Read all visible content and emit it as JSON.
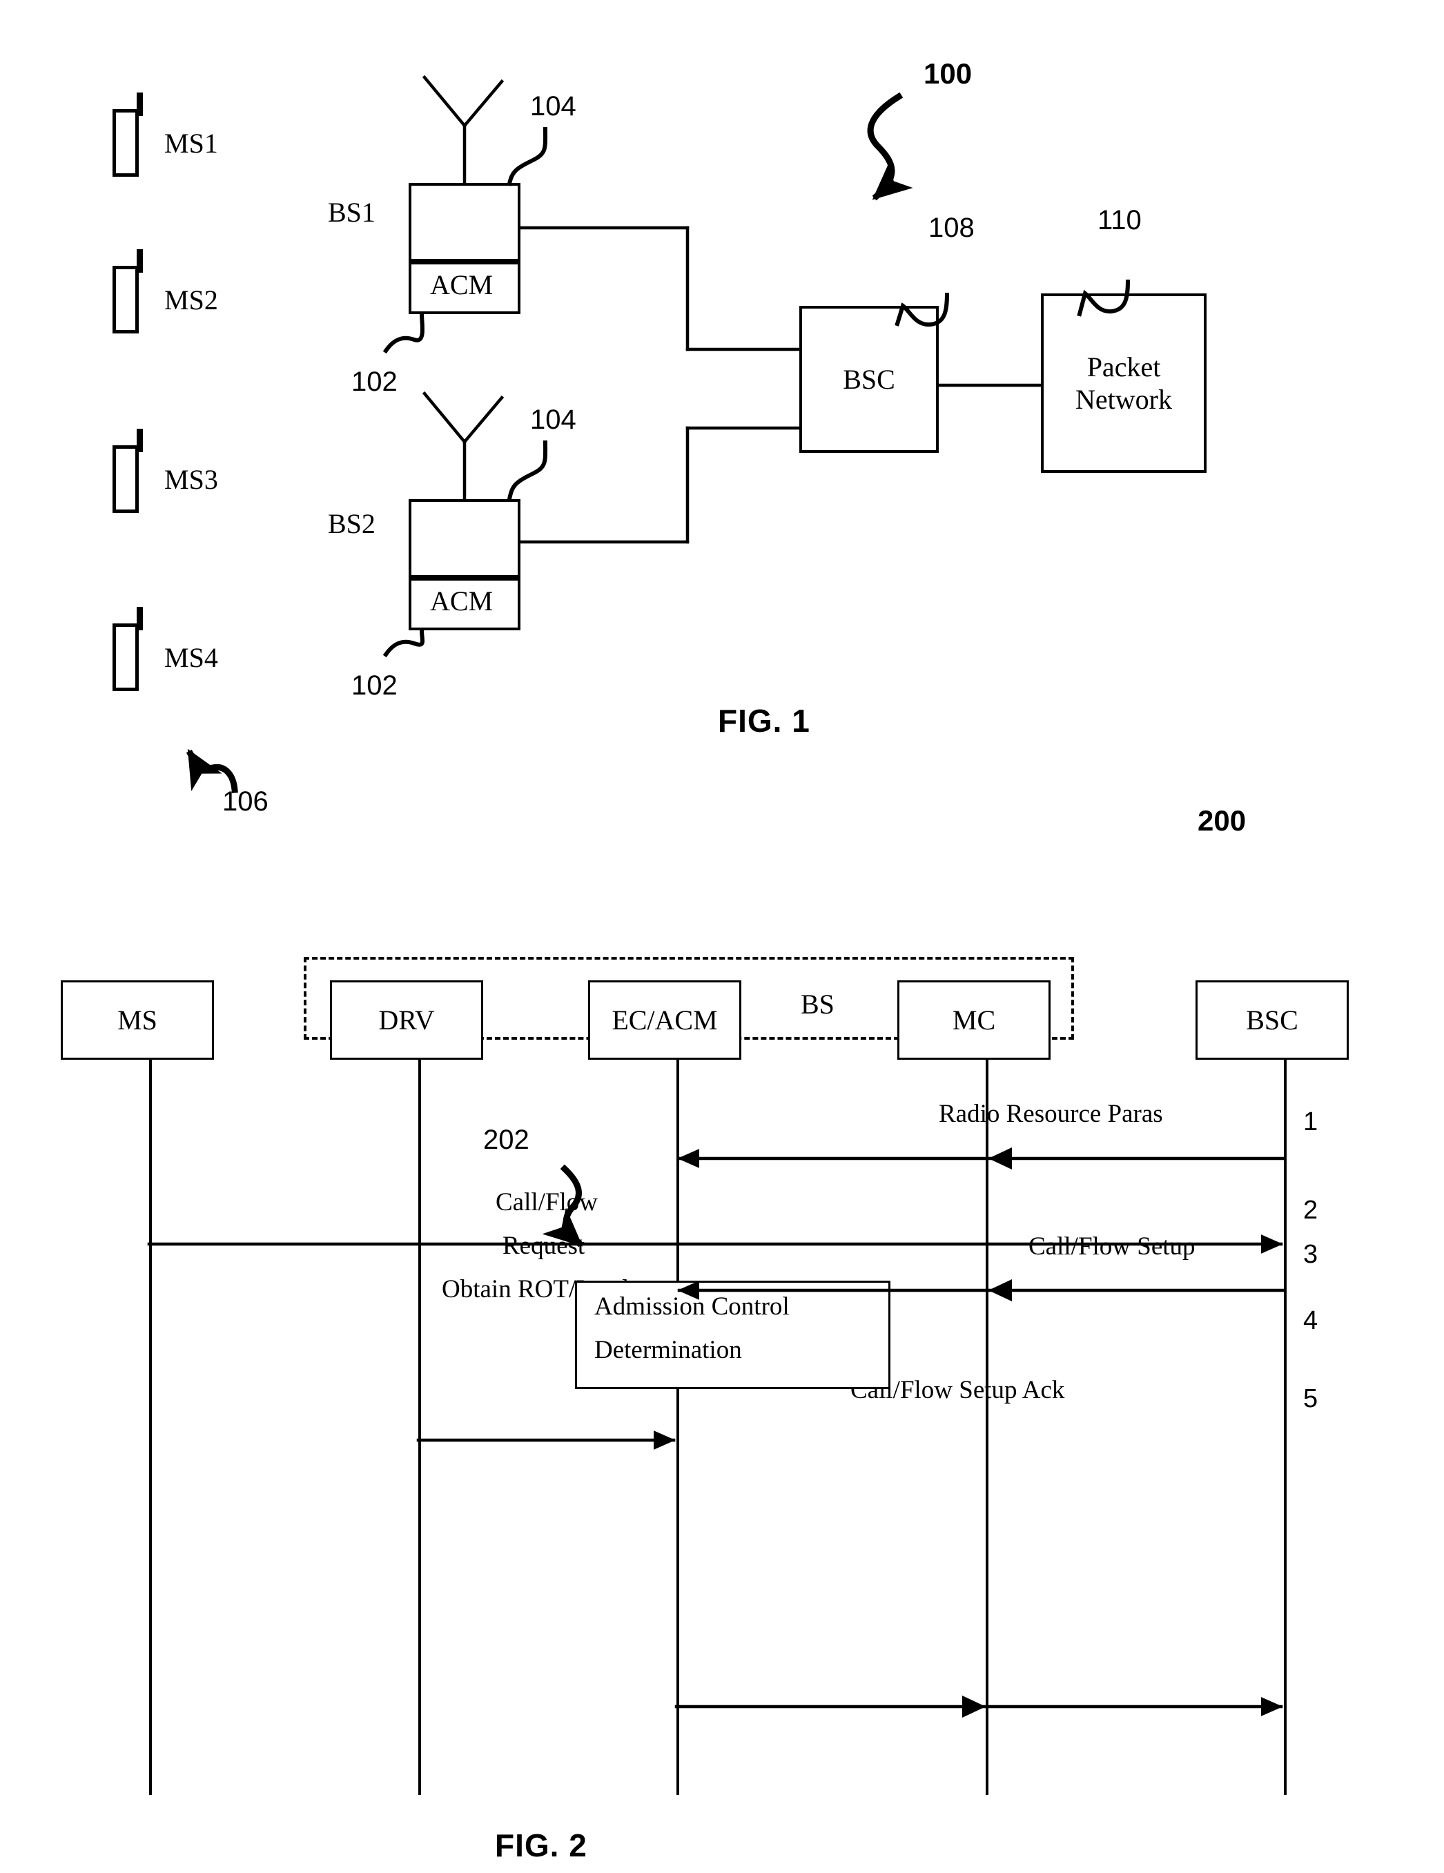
{
  "figure1": {
    "caption": "FIG. 1",
    "system_ref": "100",
    "mobile_stations": [
      {
        "label": "MS1"
      },
      {
        "label": "MS2"
      },
      {
        "label": "MS3"
      },
      {
        "label": "MS4"
      }
    ],
    "ms_group_ref": "106",
    "base_stations": [
      {
        "label": "BS1",
        "module_label": "ACM",
        "station_ref": "104",
        "module_ref": "102"
      },
      {
        "label": "BS2",
        "module_label": "ACM",
        "station_ref": "104",
        "module_ref": "102"
      }
    ],
    "controller": {
      "label": "BSC",
      "ref": "108"
    },
    "network": {
      "label_line1": "Packet",
      "label_line2": "Network",
      "ref": "110"
    }
  },
  "figure2": {
    "caption": "FIG. 2",
    "flow_ref": "200",
    "call_flow_ref": "202",
    "group_label": "BS",
    "lifelines": [
      {
        "label": "MS"
      },
      {
        "label": "DRV"
      },
      {
        "label": "EC/ACM"
      },
      {
        "label": "MC"
      },
      {
        "label": "BSC"
      }
    ],
    "messages": [
      {
        "step": "1",
        "label": "Radio Resource Paras"
      },
      {
        "step": "2",
        "label_line1": "Call/Flow",
        "label_line2": "Request"
      },
      {
        "step": "3",
        "label": "Call/Flow Setup"
      },
      {
        "step": "4",
        "label": "Obtain ROT/Load"
      },
      {
        "step": "5",
        "label": "Call/Flow Setup Ack"
      }
    ],
    "activity_box": {
      "line1": "Admission Control",
      "line2": "Determination"
    }
  },
  "colors": {
    "ink": "#000000",
    "paper": "#ffffff"
  }
}
